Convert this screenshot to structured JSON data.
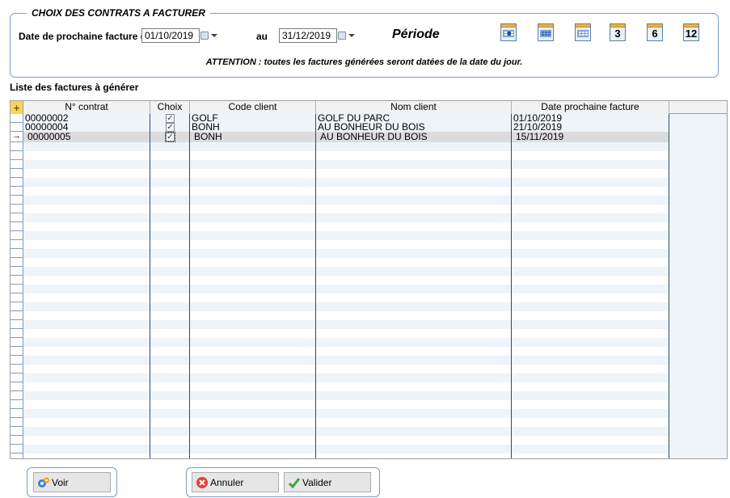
{
  "filter": {
    "legend": "CHOIX DES CONTRATS A FACTURER",
    "date_label": "Date de prochaine facture d",
    "date_from": "01/10/2019",
    "au_label": "au",
    "date_to": "31/12/2019",
    "periode_label": "Période",
    "period_buttons": [
      {
        "icon": "calendar-day-icon",
        "label": ""
      },
      {
        "icon": "calendar-week-icon",
        "label": ""
      },
      {
        "icon": "calendar-month-icon",
        "label": ""
      },
      {
        "icon": "calendar-3-months-icon",
        "label": "3"
      },
      {
        "icon": "calendar-6-months-icon",
        "label": "6"
      },
      {
        "icon": "calendar-12-months-icon",
        "label": "12"
      }
    ],
    "warning": "ATTENTION : toutes les factures générées seront datées de la date du jour."
  },
  "list": {
    "title": "Liste des factures à générer",
    "columns": [
      "N° contrat",
      "Choix",
      "Code client",
      "Nom client",
      "Date prochaine facture"
    ],
    "rows": [
      {
        "contrat": "00000002",
        "choix": true,
        "code": "GOLF",
        "nom": "GOLF DU PARC",
        "date": "01/10/2019"
      },
      {
        "contrat": "00000004",
        "choix": true,
        "code": "BONH",
        "nom": "AU BONHEUR DU BOIS",
        "date": "21/10/2019"
      },
      {
        "contrat": "00000005",
        "choix": true,
        "code": "BONH",
        "nom": "AU BONHEUR DU BOIS",
        "date": "15/11/2019"
      }
    ],
    "current_row_marker": "→"
  },
  "buttons": {
    "voir": "Voir",
    "annuler": "Annuler",
    "valider": "Valider"
  },
  "colors": {
    "accent_border": "#7a9cc8",
    "table_bg": "#eef4f8",
    "selected_row": "#dcdcdc"
  }
}
